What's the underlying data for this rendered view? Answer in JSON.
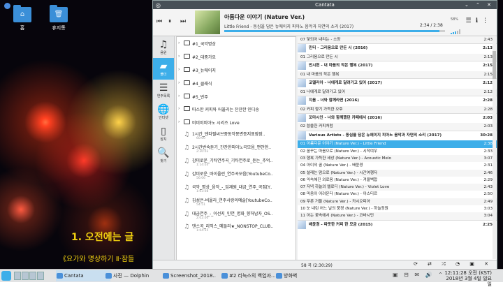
{
  "desktop": {
    "icons": [
      {
        "label": "홈",
        "glyph": "⌂"
      },
      {
        "label": "휴지통",
        "glyph": "🗑"
      }
    ],
    "overlay_line1": "1. 오전에는 글",
    "overlay_line2": "《요가와 명상하기 Ⅱ·잠들"
  },
  "window": {
    "title": "Cantata",
    "titlebar_right": "⌄ ⌃ ✕"
  },
  "player": {
    "prev_icon": "⏮",
    "pause_icon": "⏸",
    "next_icon": "⏭",
    "track_title": "아름다운 이야기 (Nature Ver.)",
    "track_artist": "Little Friend - 동심을 담은 뉴에이지 피아노 음악과 자연의 소리 (2017)",
    "time": "2:34 / 2:38",
    "progress_fraction": 0.975,
    "volume_label": "58%",
    "icons": [
      "📶",
      "☰",
      "ℹ",
      "⋮"
    ]
  },
  "sidebar": {
    "items": [
      {
        "label": "음원",
        "icon": "♫"
      },
      {
        "label": "폴더",
        "icon": "▰"
      },
      {
        "label": "연주목록",
        "icon": "☰"
      },
      {
        "label": "인터넷",
        "icon": "🌐"
      },
      {
        "label": "장치",
        "icon": "▯"
      },
      {
        "label": "찾기",
        "icon": "🔍"
      }
    ]
  },
  "folders": [
    {
      "name": "#1_국악명상",
      "type": "folder"
    },
    {
      "name": "#2_대중가요",
      "type": "folder"
    },
    {
      "name": "#3_뉴에이지",
      "type": "folder"
    },
    {
      "name": "#4_클래식",
      "type": "folder"
    },
    {
      "name": "#5_반주",
      "type": "folder"
    },
    {
      "name": "따스한 커피와 어울리는 잔잔한 인디송",
      "type": "folder"
    },
    {
      "name": "비비비피아노 시리즈 Love",
      "type": "folder"
    },
    {
      "name": "1시간_덴타펄씨브중동악몽변증지표잠잠..",
      "sub": "60:00",
      "type": "file"
    },
    {
      "name": "2시간반숙듣기_잔잔한피아노곡모음_편안한..",
      "sub": "2:30:03",
      "type": "file"
    },
    {
      "name": "감미로운_기타연주곡_기타연주로_듣는_추억..",
      "sub": "1:14:03",
      "type": "file"
    },
    {
      "name": "감미로운_바이올린_연주곡모음[YoutubeCo..",
      "sub": "56:06",
      "type": "file"
    },
    {
      "name": "국악_명상_음악_-_임재원_대금_연주_곡집[Y..",
      "sub": "1:03:08",
      "type": "file"
    },
    {
      "name": "김성은-비올라_연주사랑의예술[YoutubeCo..",
      "sub": "54:51",
      "type": "file"
    },
    {
      "name": "대금연주_-_이선지_인연_명화_향하남자_OS..",
      "sub": "2:02:00",
      "type": "file"
    },
    {
      "name": "댄스곡_리믹스_메들리★_NONSTOP_CLUB..",
      "sub": "1:04:55",
      "type": "file"
    }
  ],
  "playlist": [
    {
      "text": "07 닻되어 내리는 - 소장",
      "len": "2:43",
      "kind": "track"
    },
    {
      "text": "민티 - 그리움으로 만든 시 (2016)",
      "len": "2:13",
      "kind": "album"
    },
    {
      "text": "01 그리움으로 만든 시",
      "len": "2:13",
      "kind": "track"
    },
    {
      "text": "안시현 - 내 마음의 작은 행복 (2017)",
      "len": "2:15",
      "kind": "album"
    },
    {
      "text": "01 내 마음의 작은 행복",
      "len": "2:15",
      "kind": "track"
    },
    {
      "text": "코델리아 - 너에게로 달려가고 있어 (2017)",
      "len": "2:12",
      "kind": "album"
    },
    {
      "text": "01 너에게로 달려가고 있어",
      "len": "2:12",
      "kind": "track"
    },
    {
      "text": "지음 - 너와 함께라면 (2016)",
      "len": "2:28",
      "kind": "album"
    },
    {
      "text": "02 커피 향기 가득한 오후",
      "len": "2:28",
      "kind": "track"
    },
    {
      "text": "꼬마시인 - 너와 함께했던 카페에서 (2016)",
      "len": "2:03",
      "kind": "album"
    },
    {
      "text": "02 씁쓸한 커피처럼",
      "len": "2:03",
      "kind": "track"
    },
    {
      "text": "Various Artists - 동심을 담은 뉴에이지 피아노 음악과 자연의 소리 (2017)",
      "len": "30:28",
      "kind": "album"
    },
    {
      "text": "01 아름다운 이야기 (Nature Ver.) - Little Friend",
      "len": "2:38",
      "kind": "selected"
    },
    {
      "text": "02 꿈꾸는 마음으로 (Nature Ver.) - 시작여우",
      "len": "2:33",
      "kind": "track"
    },
    {
      "text": "03 행복 가득한 세상 (Nature Ver.) - Acoustic Melo",
      "len": "3:07",
      "kind": "track"
    },
    {
      "text": "04 아이의 꿈 (Nature Ver.) - 배윤경",
      "len": "2:31",
      "kind": "track"
    },
    {
      "text": "05 설레는 맘으로 (Nature Ver.) - 시간여행자",
      "len": "2:46",
      "kind": "track"
    },
    {
      "text": "06 익숙해진 외로움 (Nature Ver.) - 겨울백합",
      "len": "2:29",
      "kind": "track"
    },
    {
      "text": "07 저녁 하늘의 엘로디 (Nature Ver.) - Violet Love",
      "len": "2:43",
      "kind": "track"
    },
    {
      "text": "08 마음이 어려운다 (Nature Ver.) - 아스티르",
      "len": "2:50",
      "kind": "track"
    },
    {
      "text": "09 푸른 거울 (Nature Ver.) - 카시오피아",
      "len": "2:49",
      "kind": "track"
    },
    {
      "text": "10 눈 내린 어느 날의 풍경 (Nature Ver.) - 하늘정원",
      "len": "3:03",
      "kind": "track"
    },
    {
      "text": "11 아는 꽃속에서 (Nature Ver.) - 코바시민",
      "len": "3:04",
      "kind": "track"
    },
    {
      "text": "배윤경 - 따뜻한 커피 한 모금 (2015)",
      "len": "2:25",
      "kind": "album"
    }
  ],
  "status": {
    "count": "58 곡 (2:30:29)",
    "icons": "⟳ ⇄ ⤮ ◔ ▣ ✕"
  },
  "taskbar": {
    "tasks": [
      {
        "label": "Cantata",
        "active": true
      },
      {
        "label": "사진 — Dolphin",
        "active": false
      },
      {
        "label": "Screenshot_2018..",
        "active": false
      },
      {
        "label": "#2 리눅스의 백업과...",
        "active": false
      },
      {
        "label": "방화벽",
        "active": false
      }
    ],
    "tray": "▣ ⊟ ✉ 🔊 ⌃",
    "clock_time": "12:11:28 오전",
    "clock_zone": "(KST)",
    "clock_date": "2018년 3월 4일 일요일"
  }
}
